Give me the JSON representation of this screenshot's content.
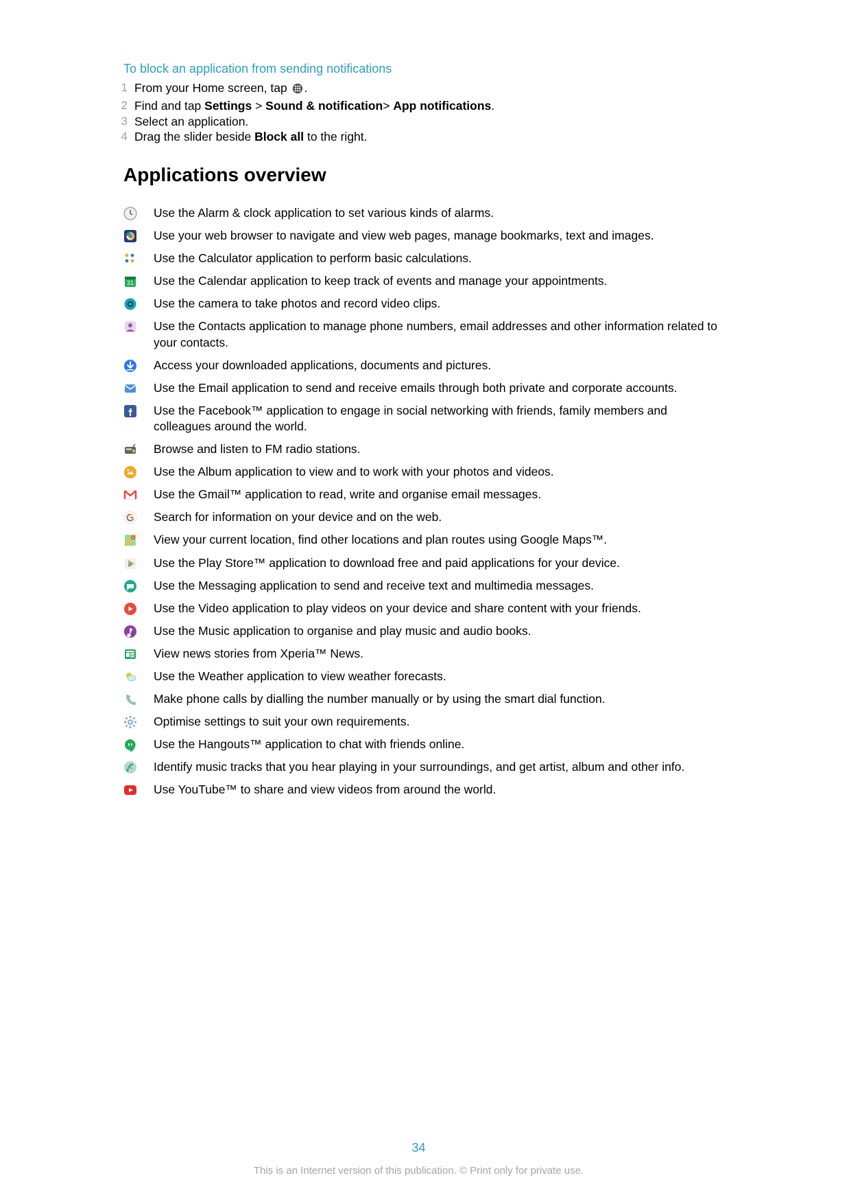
{
  "section_link": "To block an application from sending notifications",
  "steps": [
    {
      "n": "1",
      "pre": "From your Home screen, tap ",
      "post": "."
    },
    {
      "n": "2",
      "pre": "Find and tap ",
      "b1": "Settings",
      "sep1": " > ",
      "b2": "Sound & notification",
      "sep2": "> ",
      "b3": "App notifications",
      "post": "."
    },
    {
      "n": "3",
      "pre": "Select an application."
    },
    {
      "n": "4",
      "pre": "Drag the slider beside ",
      "b1": "Block all",
      "post": " to the right."
    }
  ],
  "apps_heading": "Applications overview",
  "apps": [
    {
      "icon": "alarm-clock-icon",
      "text": "Use the Alarm & clock application to set various kinds of alarms."
    },
    {
      "icon": "browser-icon",
      "text": "Use your web browser to navigate and view web pages, manage bookmarks, text and images."
    },
    {
      "icon": "calculator-icon",
      "text": "Use the Calculator application to perform basic calculations."
    },
    {
      "icon": "calendar-icon",
      "text": "Use the Calendar application to keep track of events and manage your appointments."
    },
    {
      "icon": "camera-icon",
      "text": "Use the camera to take photos and record video clips."
    },
    {
      "icon": "contacts-icon",
      "text": "Use the Contacts application to manage phone numbers, email addresses and other information related to your contacts."
    },
    {
      "icon": "downloads-icon",
      "text": "Access your downloaded applications, documents and pictures."
    },
    {
      "icon": "email-icon",
      "text": "Use the Email application to send and receive emails through both private and corporate accounts."
    },
    {
      "icon": "facebook-icon",
      "text": "Use the Facebook™ application to engage in social networking with friends, family members and colleagues around the world."
    },
    {
      "icon": "fm-radio-icon",
      "text": "Browse and listen to FM radio stations."
    },
    {
      "icon": "album-icon",
      "text": "Use the Album application to view and to work with your photos and videos."
    },
    {
      "icon": "gmail-icon",
      "text": "Use the Gmail™ application to read, write and organise email messages."
    },
    {
      "icon": "google-icon",
      "text": "Search for information on your device and on the web."
    },
    {
      "icon": "maps-icon",
      "text": "View your current location, find other locations and plan routes using Google Maps™."
    },
    {
      "icon": "play-store-icon",
      "text": "Use the Play Store™ application to download free and paid applications for your device."
    },
    {
      "icon": "messaging-icon",
      "text": "Use the Messaging application to send and receive text and multimedia messages."
    },
    {
      "icon": "video-icon",
      "text": "Use the Video application to play videos on your device and share content with your friends."
    },
    {
      "icon": "music-icon",
      "text": "Use the Music application to organise and play music and audio books."
    },
    {
      "icon": "news-icon",
      "text": "View news stories from Xperia™ News."
    },
    {
      "icon": "weather-icon",
      "text": "Use the Weather application to view weather forecasts."
    },
    {
      "icon": "phone-icon",
      "text": "Make phone calls by dialling the number manually or by using the smart dial function."
    },
    {
      "icon": "settings-icon",
      "text": "Optimise settings to suit your own requirements."
    },
    {
      "icon": "hangouts-icon",
      "text": "Use the Hangouts™ application to chat with friends online."
    },
    {
      "icon": "track-id-icon",
      "text": "Identify music tracks that you hear playing in your surroundings, and get artist, album and other info."
    },
    {
      "icon": "youtube-icon",
      "text": "Use YouTube™ to share and view videos from around the world."
    }
  ],
  "page_number": "34",
  "footer": "This is an Internet version of this publication. © Print only for private use."
}
